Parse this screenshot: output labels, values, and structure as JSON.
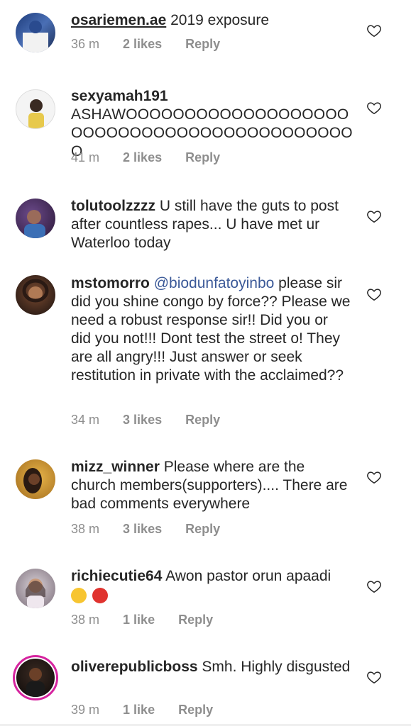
{
  "comments": [
    {
      "username": "osariemen.ae",
      "text": "2019 exposure",
      "time": "36 m",
      "likes": "2 likes",
      "reply": "Reply"
    },
    {
      "username": "sexyamah191",
      "text": "ASHAWOOOOOOOOOOOOOOOOOOOOOOOOOOOOOOOOOOOOOOOOOOOO",
      "time": "41 m",
      "likes": "2 likes",
      "reply": "Reply"
    },
    {
      "username": "tolutoolzzzz",
      "text": "U still have the guts to post after countless rapes... U have met ur Waterloo today",
      "time": "",
      "likes": "",
      "reply": ""
    },
    {
      "username": "mstomorro",
      "mention": "@biodunfatoyinbo",
      "text": "please sir did you shine congo by force?? Please we need a robust response sir!! Did you or did you not!!! Dont test the street o! They are all angry!!! Just answer or seek restitution in private with the acclaimed??",
      "time": "34 m",
      "likes": "3 likes",
      "reply": "Reply"
    },
    {
      "username": "mizz_winner",
      "text": "Please where are the church members(supporters).... There are bad comments everywhere",
      "time": "38 m",
      "likes": "3 likes",
      "reply": "Reply"
    },
    {
      "username": "richiecutie64",
      "text": "Awon pastor orun apaadi",
      "time": "38 m",
      "likes": "1 like",
      "reply": "Reply"
    },
    {
      "username": "oliverepublicboss",
      "text": "Smh. Highly disgusted",
      "time": "39 m",
      "likes": "1 like",
      "reply": "Reply"
    }
  ],
  "colors": {
    "mention": "#3b5998",
    "meta": "#8e8e8e",
    "story_ring": "#d6249f"
  },
  "icons": {
    "heart": "heart-outline-icon"
  }
}
